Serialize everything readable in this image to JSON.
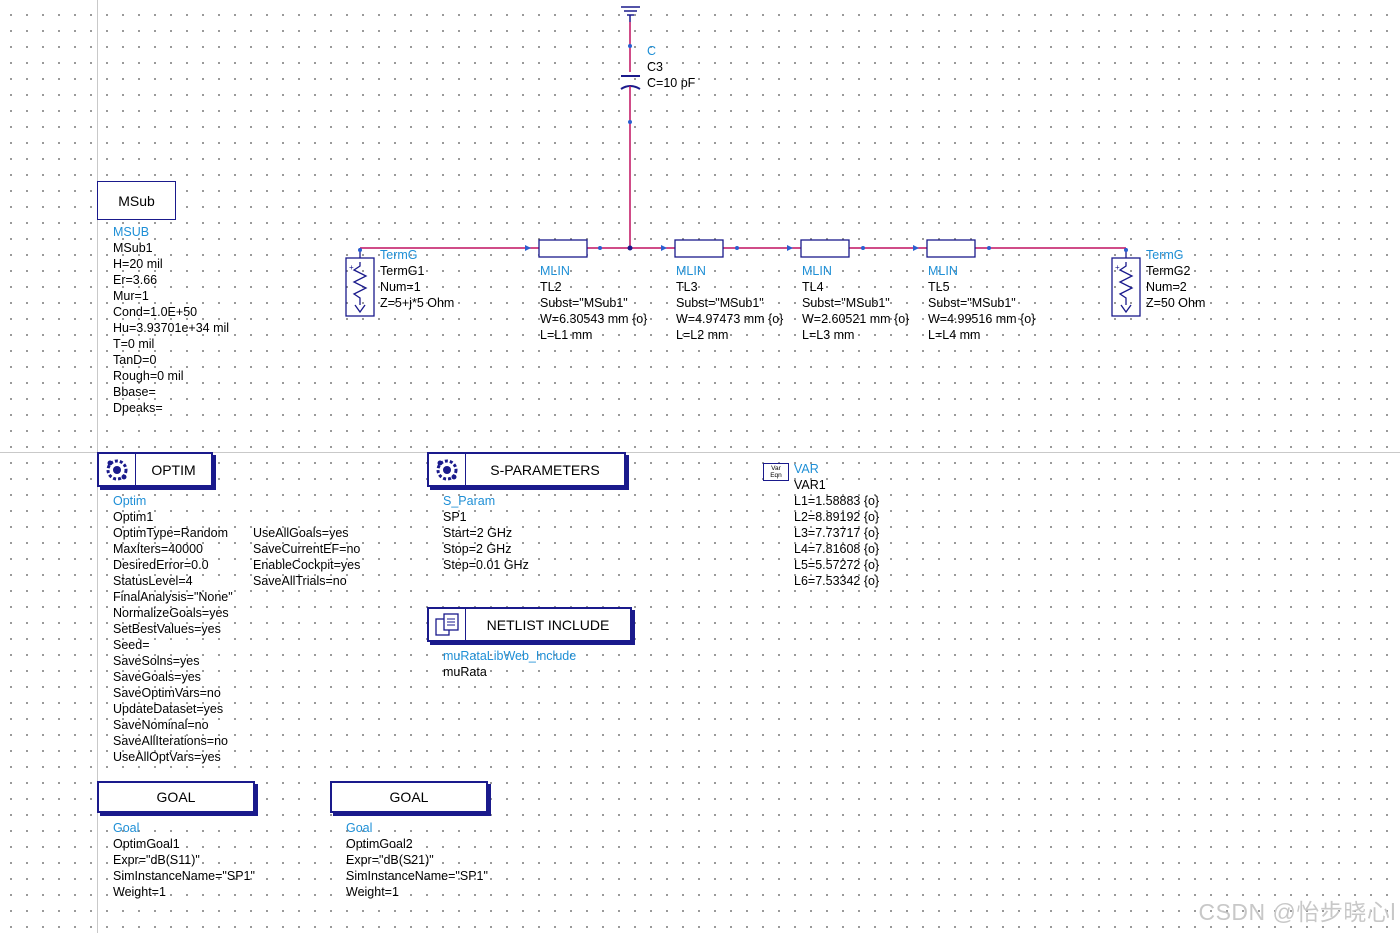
{
  "msub": {
    "box_label": "MSub",
    "lines": [
      "MSUB",
      "MSub1",
      "H=20 mil",
      "Er=3.66",
      "Mur=1",
      "Cond=1.0E+50",
      "Hu=3.93701e+34 mil",
      "T=0 mil",
      "TanD=0",
      "Rough=0 mil",
      "Bbase=",
      "Dpeaks="
    ]
  },
  "capacitor": {
    "lines": [
      "C",
      "C3",
      "C=10 pF"
    ]
  },
  "term1": {
    "lines": [
      "TermG",
      "TermG1",
      "Num=1",
      "Z=5+j*5 Ohm"
    ]
  },
  "term2": {
    "lines": [
      "TermG",
      "TermG2",
      "Num=2",
      "Z=50 Ohm"
    ]
  },
  "tl2": {
    "lines": [
      "MLIN",
      "TL2",
      "Subst=\"MSub1\"",
      "W=6.30543 mm {o}",
      "L=L1 mm"
    ]
  },
  "tl3": {
    "lines": [
      "MLIN",
      "TL3",
      "Subst=\"MSub1\"",
      "W=4.97473 mm {o}",
      "L=L2 mm"
    ]
  },
  "tl4": {
    "lines": [
      "MLIN",
      "TL4",
      "Subst=\"MSub1\"",
      "W=2.60521 mm {o}",
      "L=L3 mm"
    ]
  },
  "tl5": {
    "lines": [
      "MLIN",
      "TL5",
      "Subst=\"MSub1\"",
      "W=4.99516 mm {o}",
      "L=L4 mm"
    ]
  },
  "optim": {
    "box_label": "OPTIM",
    "lines": [
      "Optim",
      "Optim1",
      "OptimType=Random",
      "MaxIters=40000",
      "DesiredError=0.0",
      "StatusLevel=4",
      "FinalAnalysis=\"None\"",
      "NormalizeGoals=yes",
      "SetBestValues=yes",
      "Seed=",
      "SaveSolns=yes",
      "SaveGoals=yes",
      "SaveOptimVars=no",
      "UpdateDataset=yes",
      "SaveNominal=no",
      "SaveAllIterations=no",
      "UseAllOptVars=yes"
    ],
    "lines2": [
      "UseAllGoals=yes",
      "SaveCurrentEF=no",
      "EnableCockpit=yes",
      "SaveAllTrials=no"
    ]
  },
  "sparams": {
    "box_label": "S-PARAMETERS",
    "lines": [
      "S_Param",
      "SP1",
      "Start=2 GHz",
      "Stop=2 GHz",
      "Step=0.01 GHz"
    ]
  },
  "netlist": {
    "box_label": "NETLIST INCLUDE",
    "lines": [
      "muRataLibWeb_Include",
      "muRata"
    ]
  },
  "var": {
    "icon_text_top": "Var",
    "icon_text_bottom": "Eqn",
    "lines": [
      "VAR",
      "VAR1",
      "L1=1.58883 {o}",
      "L2=8.89192 {o}",
      "L3=7.73717 {o}",
      "L4=7.81608 {o}",
      "L5=5.57272 {o}",
      "L6=7.53342 {o}"
    ]
  },
  "goal1": {
    "box_label": "GOAL",
    "lines": [
      "Goal",
      "OptimGoal1",
      "Expr=\"dB(S11)\"",
      "SimInstanceName=\"SP1\"",
      "Weight=1"
    ]
  },
  "goal2": {
    "box_label": "GOAL",
    "lines": [
      "Goal",
      "OptimGoal2",
      "Expr=\"dB(S21)\"",
      "SimInstanceName=\"SP1\"",
      "Weight=1"
    ]
  },
  "watermark": "CSDN @怡步晓心l",
  "colors": {
    "wire": "#c01060",
    "component": "#1a1a8c",
    "label_blue": "#1e8fd6",
    "pin": "#2a5fd0"
  }
}
